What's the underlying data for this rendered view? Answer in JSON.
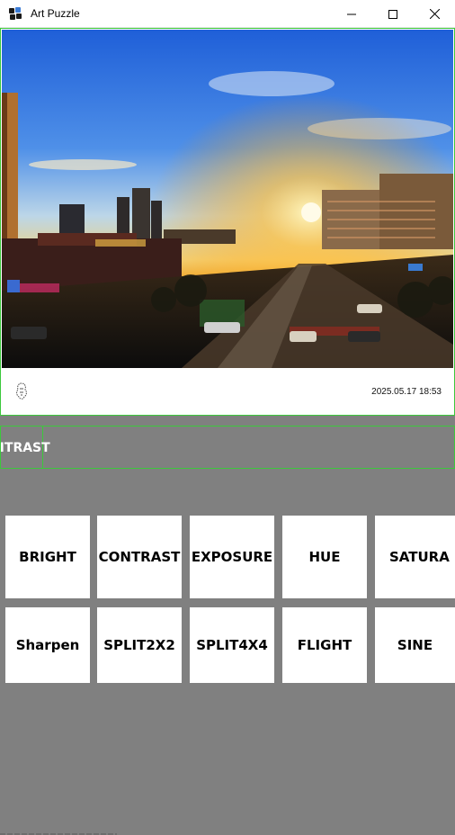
{
  "window": {
    "title": "Art Puzzle",
    "app_icon": "puzzle-app-icon",
    "controls": [
      "minimize-icon",
      "maximize-icon",
      "close-icon"
    ]
  },
  "photo": {
    "timestamp": "2025.05.17 18:53",
    "stamp_icon": "photo-stamp-icon",
    "scene": "city-sunset"
  },
  "filter_strip": {
    "current_filter": "CONTRAST"
  },
  "filters": {
    "row1": [
      "BRIGHT",
      "CONTRAST",
      "EXPOSURE",
      "HUE",
      "SATURA"
    ],
    "row2": [
      "Sharpen",
      "SPLIT2X2",
      "SPLIT4X4",
      "FLIGHT",
      "SINE"
    ]
  },
  "colors": {
    "background": "#808080",
    "outline": "#3cc83c",
    "button": "#ffffff"
  }
}
